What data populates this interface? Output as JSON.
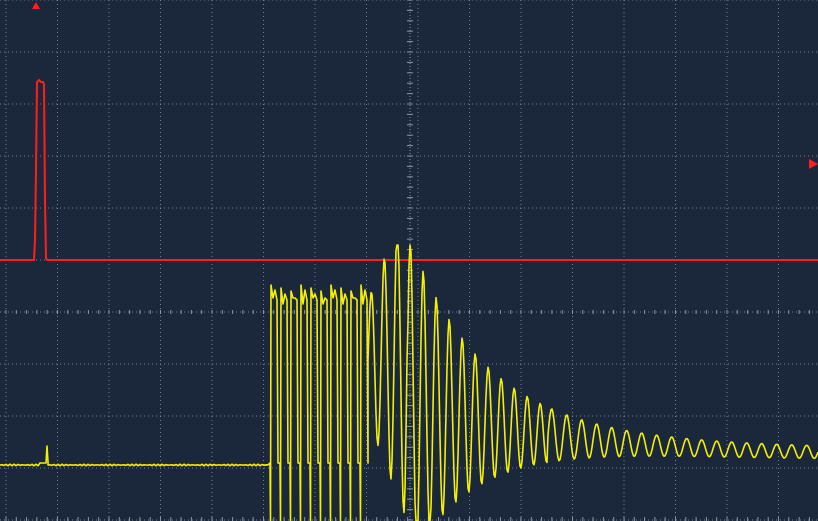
{
  "screen": {
    "background": "#1b273a",
    "grid_color": "#8a96a8",
    "grid": {
      "h_divisions": 16,
      "v_divisions": 10
    }
  },
  "channels": [
    {
      "id": "CH1",
      "color": "#ff1e1e",
      "marker": "trigger-position-marker",
      "level_marker": "trigger-level-marker"
    },
    {
      "id": "CH2",
      "color": "#f4f000"
    }
  ]
}
